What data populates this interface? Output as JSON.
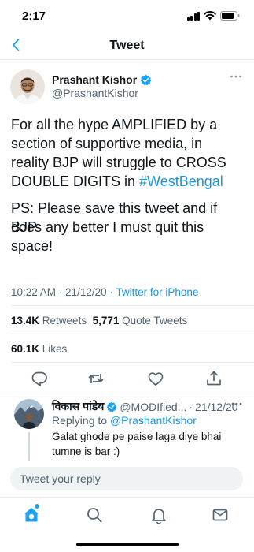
{
  "status_bar": {
    "time": "2:17"
  },
  "header": {
    "title": "Tweet"
  },
  "tweet": {
    "author_name": "Prashant Kishor",
    "author_handle": "@PrashantKishor",
    "text_line1": "For all the hype AMPLIFIED by a",
    "text_line2": "section of supportive media, in",
    "text_line3": "reality BJP will struggle to CROSS",
    "text_line4_prefix": "DOUBLE DIGITS in ",
    "text_line4_tag": "#WestBengal",
    "text_line5": "PS: Please save this tweet and if BJP",
    "text_line6": "does any better I must quit this",
    "text_line7": "space!",
    "time": "10:22 AM",
    "date": "21/12/20",
    "separator": "·",
    "source": "Twitter for iPhone",
    "retweets_count": "13.4K",
    "retweets_label": "Retweets",
    "quotes_count": "5,771",
    "quotes_label": "Quote Tweets",
    "likes_count": "60.1K",
    "likes_label": "Likes"
  },
  "reply": {
    "author_name": "विकास पांडेय",
    "author_handle": "@MODIfied...",
    "separator": "·",
    "date": "21/12/20",
    "replying_label": "Replying to",
    "replying_handle": "@PrashantKishor",
    "text_line1": "Galat ghode pe paise laga diye bhai",
    "text_line2": "tumne is bar :)"
  },
  "compose": {
    "placeholder": "Tweet your reply"
  },
  "colors": {
    "accent": "#1da1f2",
    "link": "#1b95e0",
    "text": "#0f1419",
    "muted": "#536471"
  }
}
